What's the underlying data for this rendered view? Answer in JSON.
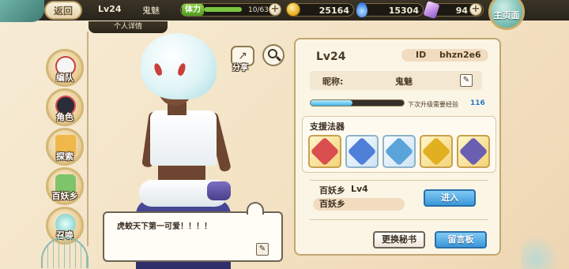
{
  "topbar": {
    "back_label": "返回",
    "level": "Lv24",
    "player_name": "鬼魅",
    "stamina_label": "体力",
    "stamina_value": "10/63",
    "stamina_fraction": 0.16,
    "coins": "25164",
    "gems": "15304",
    "crystals": "94",
    "home_label": "主页面"
  },
  "title_tab": "个人详情",
  "sidenav": {
    "items": [
      {
        "label": "编队",
        "color": "#f3f3f3"
      },
      {
        "label": "角色",
        "color": "#2b2b3a"
      },
      {
        "label": "探索",
        "color": "#f0b84a"
      },
      {
        "label": "百妖乡",
        "color": "#7ec46a"
      },
      {
        "label": "召唤",
        "color": "#6cc6c0"
      }
    ]
  },
  "character": {
    "share_label": "分享",
    "speech": "虎蛟天下第一可爱！！！！"
  },
  "profile": {
    "level": "Lv24",
    "id_label": "ID",
    "id_value": "bhzn2e6",
    "nickname_label": "昵称:",
    "nickname": "鬼魅",
    "exp_fraction": 0.45,
    "exp_text": "下次升级需要经验",
    "exp_needed": "116",
    "support_title": "支援法器",
    "tools": [
      {
        "icon": "staff-gem-icon",
        "color": "#d94f4f"
      },
      {
        "icon": "crystal-mace-icon",
        "color": "#4f7fd9"
      },
      {
        "icon": "blue-fan-icon",
        "color": "#5aa4d9"
      },
      {
        "icon": "golden-sword-icon",
        "color": "#e0b021"
      },
      {
        "icon": "gold-blade-icon",
        "color": "#6a5fb0"
      }
    ],
    "village_label": "百妖乡",
    "village_level": "Lv4",
    "village_name": "百妖乡",
    "enter_label": "进入",
    "change_book_label": "更换秘书",
    "message_board_label": "留言板"
  }
}
